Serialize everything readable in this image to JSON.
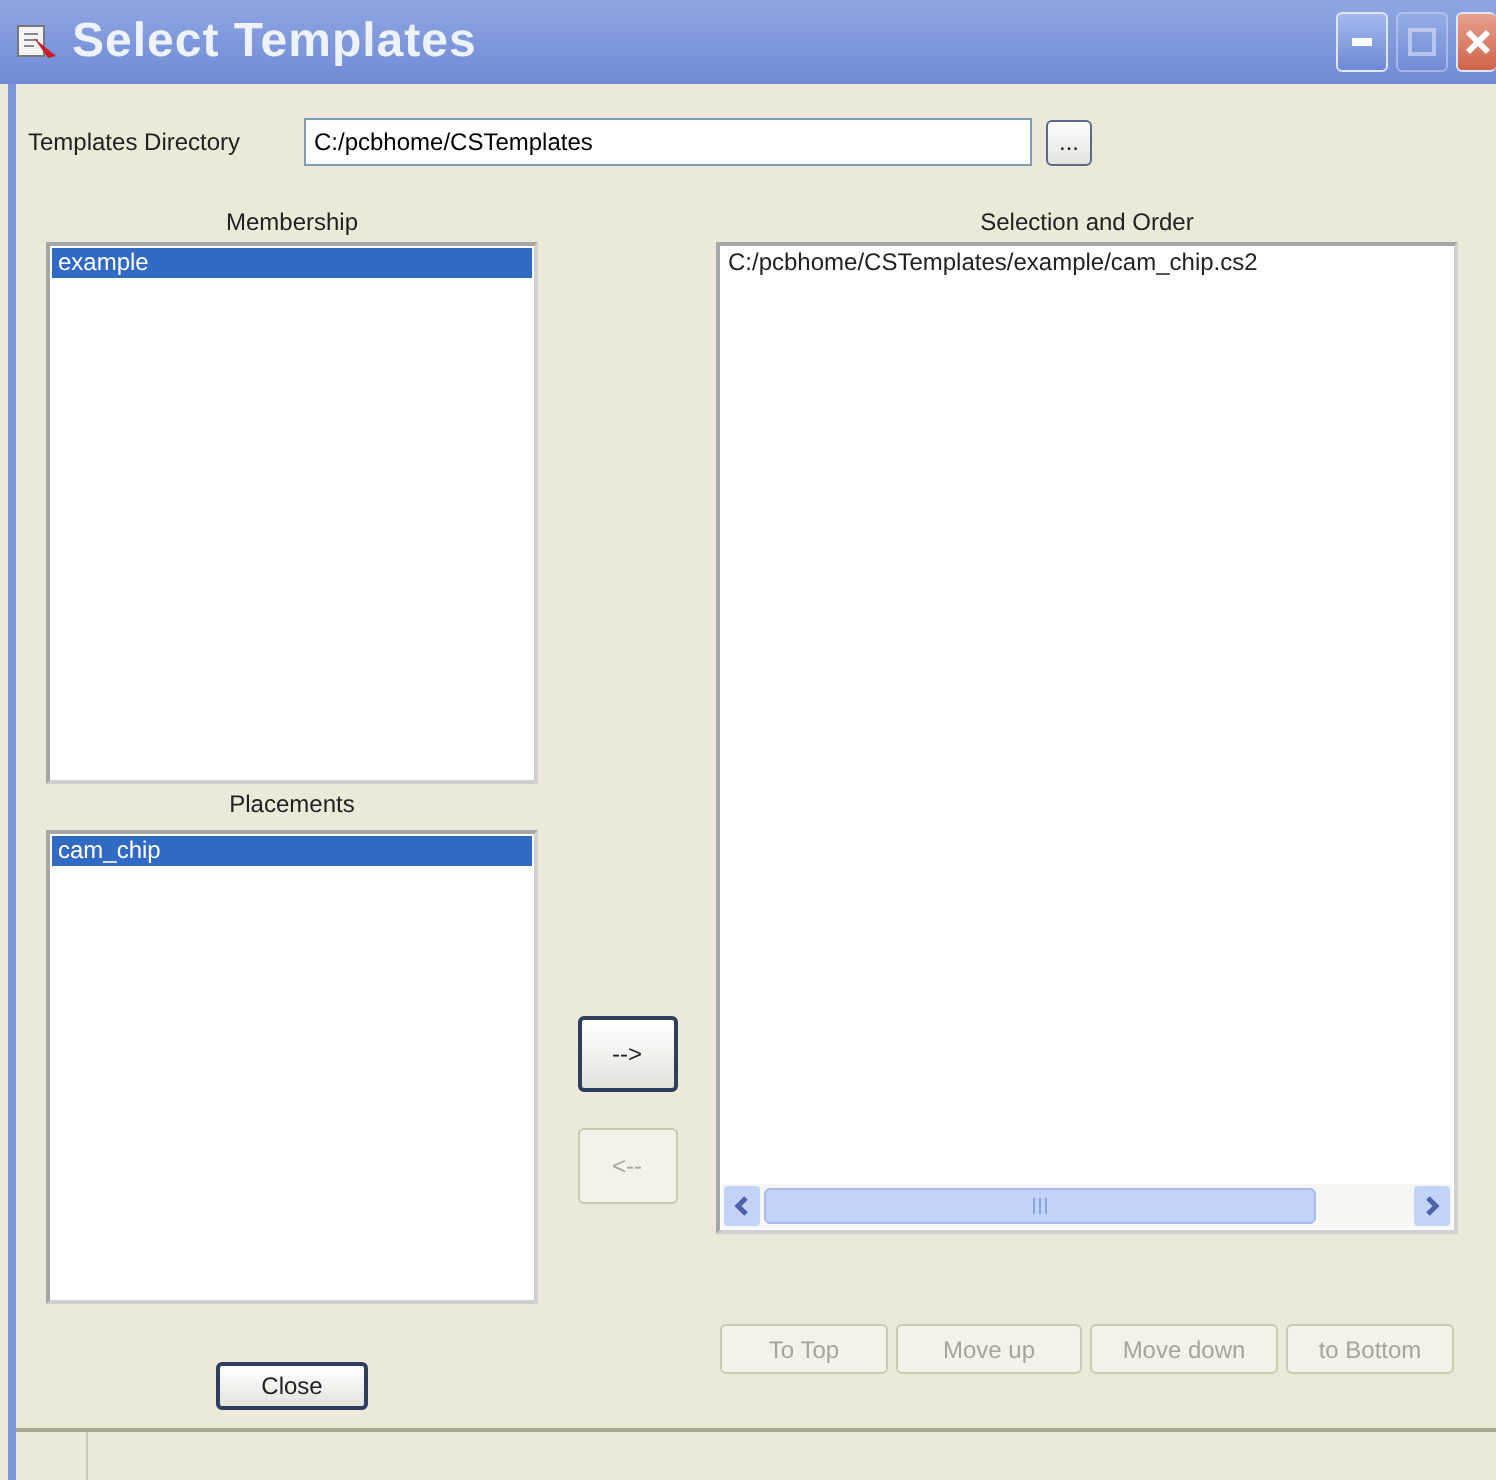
{
  "window": {
    "title": "Select Templates"
  },
  "directory": {
    "label": "Templates Directory",
    "value": "C:/pcbhome/CSTemplates",
    "browse_button": "..."
  },
  "membership": {
    "label": "Membership",
    "items": [
      {
        "text": "example",
        "selected": true
      }
    ]
  },
  "placements": {
    "label": "Placements",
    "items": [
      {
        "text": "cam_chip",
        "selected": true
      }
    ]
  },
  "transfer_buttons": [
    {
      "label": "-->",
      "disabled": false
    },
    {
      "label": "<--",
      "disabled": true
    }
  ],
  "selection": {
    "label": "Selection and Order",
    "items": [
      {
        "text": "C:/pcbhome/CSTemplates/example/cam_chip.cs2",
        "selected": false
      }
    ]
  },
  "order_buttons": [
    {
      "label": "To Top",
      "disabled": true
    },
    {
      "label": "Move up",
      "disabled": true
    },
    {
      "label": "Move down",
      "disabled": true
    },
    {
      "label": "to Bottom",
      "disabled": true
    }
  ],
  "close_button": "Close"
}
